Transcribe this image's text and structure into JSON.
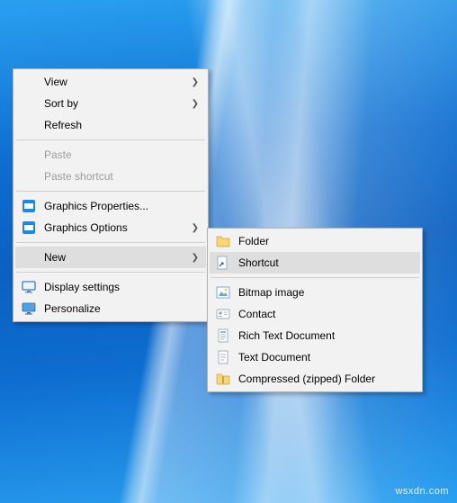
{
  "desktop": {
    "watermark": "wsxdn.com"
  },
  "primaryMenu": {
    "view": "View",
    "sortBy": "Sort by",
    "refresh": "Refresh",
    "paste": "Paste",
    "pasteShortcut": "Paste shortcut",
    "graphicsProperties": "Graphics Properties...",
    "graphicsOptions": "Graphics Options",
    "new": "New",
    "displaySettings": "Display settings",
    "personalize": "Personalize"
  },
  "subMenu": {
    "folder": "Folder",
    "shortcut": "Shortcut",
    "bitmap": "Bitmap image",
    "contact": "Contact",
    "richText": "Rich Text Document",
    "textDoc": "Text Document",
    "zipped": "Compressed (zipped) Folder"
  },
  "arrows": {
    "right": "❯"
  }
}
